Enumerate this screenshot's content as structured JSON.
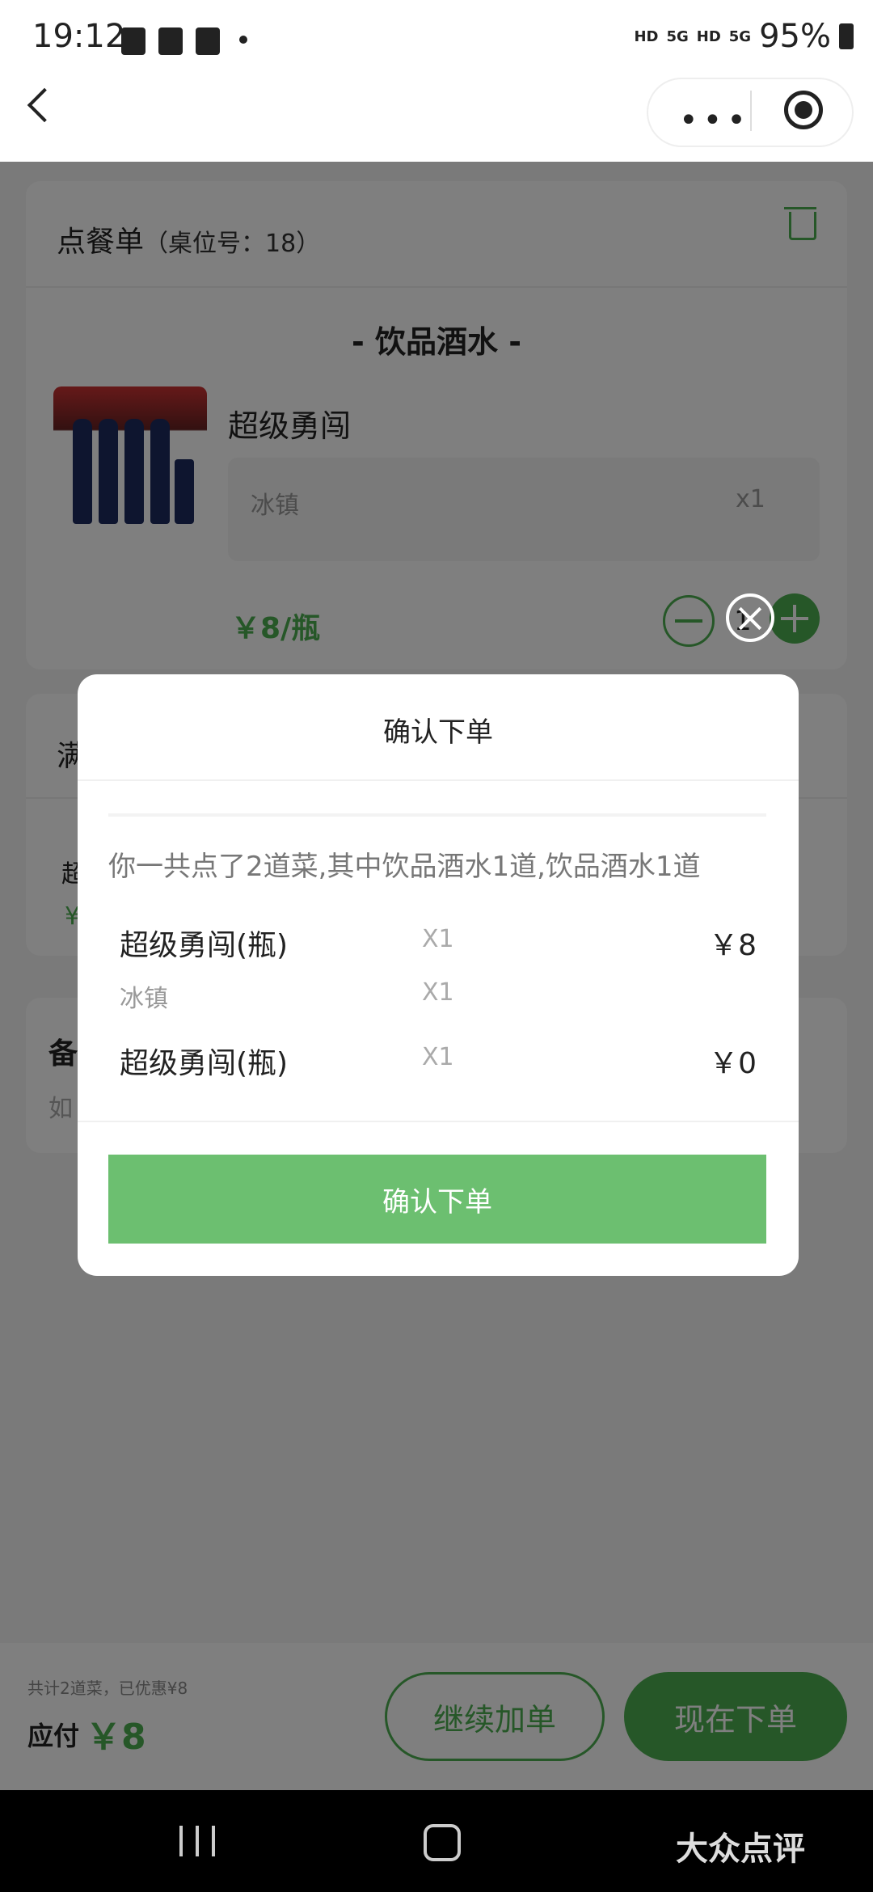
{
  "status_bar": {
    "time": "19:12",
    "network1": "HD",
    "network2": "5G",
    "network3": "HD",
    "network4": "5G",
    "battery": "95%"
  },
  "nav": {
    "more": "•••"
  },
  "order": {
    "title": "点餐单",
    "table": "（桌位号：18）",
    "section": "- 饮品酒水 -",
    "item_name": "超级勇闯",
    "spec": "冰镇",
    "spec_qty": "x1",
    "price": "￥8/瓶",
    "stepper_value": "1"
  },
  "card2": {
    "title": "满",
    "line1": "超",
    "line2": "¥"
  },
  "card3": {
    "title": "备",
    "hint": "如"
  },
  "bottom": {
    "summary": "共计2道菜，已优惠¥8",
    "pay_label": "应付",
    "pay_amount": "￥8",
    "continue_label": "继续加单",
    "order_label": "现在下单"
  },
  "modal": {
    "title": "确认下单",
    "summary": "你一共点了2道菜,其中饮品酒水1道,饮品酒水1道",
    "rows": [
      {
        "name": "超级勇闯(瓶)",
        "qty": "X1",
        "price": "￥8"
      },
      {
        "name": "冰镇",
        "qty": "X1",
        "price": ""
      },
      {
        "name": "超级勇闯(瓶)",
        "qty": "X1",
        "price": "￥0"
      }
    ],
    "confirm_label": "确认下单"
  },
  "watermark": "大众点评",
  "colors": {
    "accent": "#4caf50",
    "overlay": "rgba(0,0,0,0.5)"
  }
}
